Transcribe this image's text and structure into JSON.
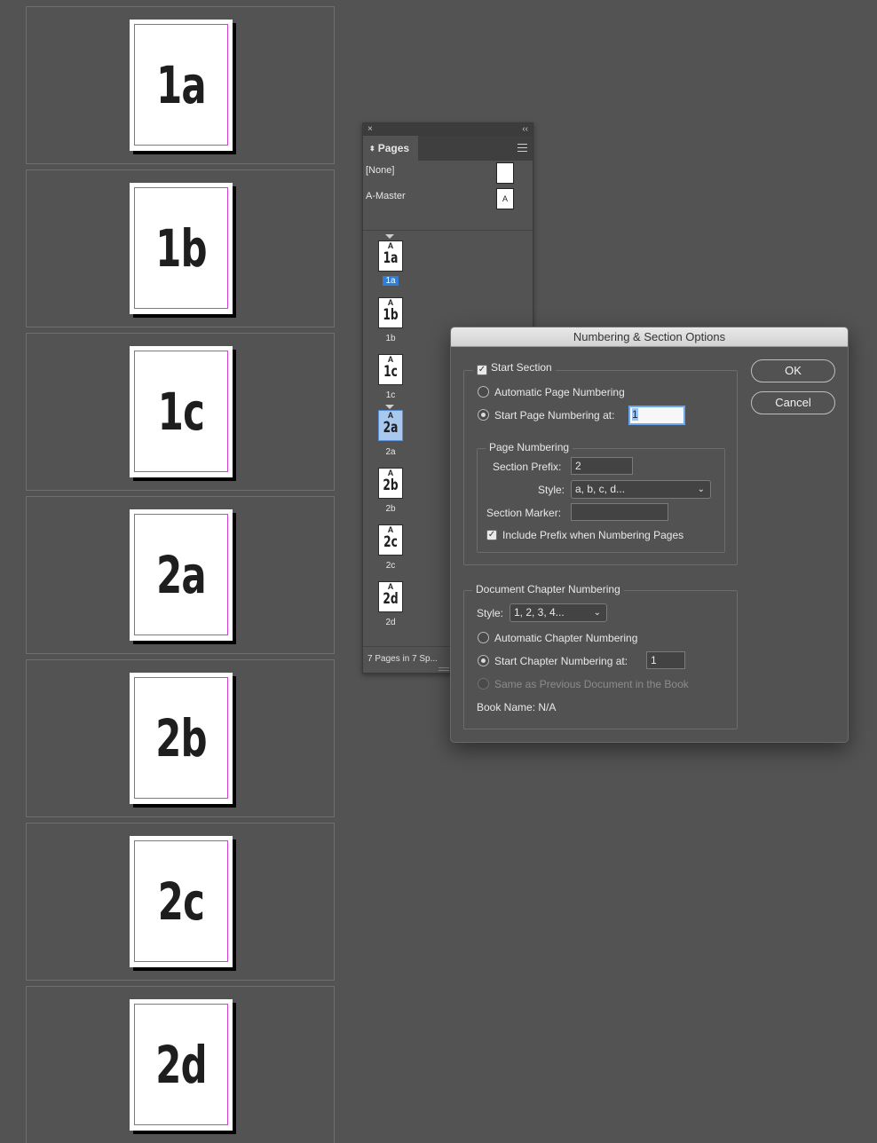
{
  "spreads": [
    {
      "label": "1a"
    },
    {
      "label": "1b"
    },
    {
      "label": "1c"
    },
    {
      "label": "2a"
    },
    {
      "label": "2b"
    },
    {
      "label": "2c"
    },
    {
      "label": "2d"
    }
  ],
  "pages_panel": {
    "close_glyph": "×",
    "collapse_glyph": "‹‹",
    "tab_arrows": "⬍",
    "tab_label": "Pages",
    "masters": [
      {
        "name": "[None]",
        "thumb": ""
      },
      {
        "name": "A-Master",
        "thumb": "A"
      }
    ],
    "thumbs": [
      {
        "master": "A",
        "label": "1a",
        "caption": "1a"
      },
      {
        "master": "A",
        "label": "1b",
        "caption": "1b"
      },
      {
        "master": "A",
        "label": "1c",
        "caption": "1c"
      },
      {
        "master": "A",
        "label": "2a",
        "caption": "2a"
      },
      {
        "master": "A",
        "label": "2b",
        "caption": "2b"
      },
      {
        "master": "A",
        "label": "2c",
        "caption": "2c"
      },
      {
        "master": "A",
        "label": "2d",
        "caption": "2d"
      }
    ],
    "status": "7 Pages in 7 Sp..."
  },
  "dialog": {
    "title": "Numbering & Section Options",
    "start_section": {
      "label": "Start Section",
      "checked": true
    },
    "automatic_page_numbering": "Automatic Page Numbering",
    "start_page_numbering_at": {
      "label": "Start Page Numbering at:",
      "value": "1"
    },
    "page_numbering": {
      "legend": "Page Numbering",
      "section_prefix_label": "Section Prefix:",
      "section_prefix_value": "2",
      "style_label": "Style:",
      "style_value": "a, b, c, d...",
      "section_marker_label": "Section Marker:",
      "section_marker_value": "",
      "include_prefix_label": "Include Prefix when Numbering Pages",
      "include_prefix_checked": true
    },
    "chapter": {
      "legend": "Document Chapter Numbering",
      "style_label": "Style:",
      "style_value": "1, 2, 3, 4...",
      "automatic_chapter_numbering": "Automatic Chapter Numbering",
      "start_chapter_numbering_at": {
        "label": "Start Chapter Numbering at:",
        "value": "1"
      },
      "same_as_previous": "Same as Previous Document in the Book",
      "book_name": "Book Name: N/A"
    },
    "ok_label": "OK",
    "cancel_label": "Cancel",
    "check_glyph": "✓",
    "chevron_glyph": "⌄"
  },
  "colors": {
    "pasteboard": "#535353",
    "margin_guide": "#d63ad6",
    "selection_blue": "#2f7fd9",
    "focus_ring": "#6aa7f2"
  },
  "icons": [
    "close-icon",
    "collapse-icon",
    "panel-menu-icon",
    "section-marker-icon",
    "checkbox-icon",
    "radio-icon",
    "chevron-down-icon"
  ]
}
